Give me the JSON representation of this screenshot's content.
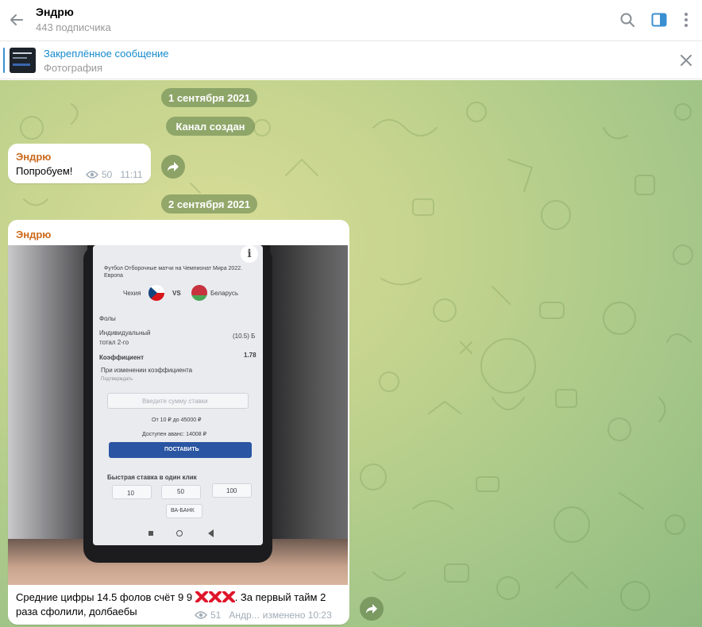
{
  "header": {
    "title": "Эндрю",
    "subtitle": "443 подписчика"
  },
  "pinned": {
    "title": "Закреплённое сообщение",
    "subtitle": "Фотография"
  },
  "chat": {
    "date1": "1 сентября 2021",
    "service": "Канал создан",
    "date2": "2 сентября 2021",
    "messages": [
      {
        "author": "Эндрю",
        "text": "Попробуем!",
        "views": "50",
        "time": "11:11"
      },
      {
        "author": "Эндрю",
        "caption_line1": "Средние цифры 14.5 фолов счёт 9 9",
        "caption_line1_after": ". За первый тайм 2",
        "caption_line2": "раза сфолили, долбаебы",
        "views": "51",
        "signature": "Андр...",
        "edited_time": "изменено 10:23"
      }
    ]
  },
  "photo_screen": {
    "tournament": "Футбол Отборочные матчи на Чемпионат Мира 2022.",
    "tournament2": "Европа",
    "team1": "Чехия",
    "vs": "VS",
    "team2": "Беларусь",
    "section": "Фолы",
    "bet_line1": "Индивидуальный",
    "bet_line2": "тотал 2-го",
    "bet_value": "(10.5) Б",
    "coef_label": "Коэффициент",
    "coef_value": "1.78",
    "change_label": "При изменении коэффициента",
    "change_value": "Подтверждать",
    "input_placeholder": "Введите сумму ставки",
    "range": "От 10 ₽ до 45000 ₽",
    "available": "Доступен аванс: 14008 ₽",
    "place_button": "ПОСТАВИТЬ",
    "quick_title": "Быстрая ставка в один клик",
    "quick": [
      "10",
      "50",
      "100"
    ],
    "va_bank": "ВА-БАНК"
  },
  "colors": {
    "accent": "#168acd",
    "author": "#cc6a1d",
    "emoji_x": "#e0162b"
  },
  "icons": [
    "back-arrow-icon",
    "search-icon",
    "sidebar-toggle-icon",
    "more-vertical-icon",
    "close-icon",
    "forward-icon",
    "views-eye-icon",
    "cross-mark-icon"
  ]
}
